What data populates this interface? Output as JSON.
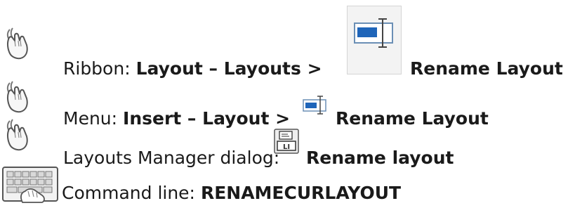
{
  "rows": [
    {
      "label": "Ribbon: ",
      "path": "Layout – Layouts >",
      "command": "Rename Layout",
      "input_icon": "mouse-pointer-icon",
      "tool_icon": "rename-layout-ribbon-icon"
    },
    {
      "label": "Menu: ",
      "path": "Insert – Layout >",
      "command": "Rename Layout",
      "input_icon": "mouse-pointer-icon",
      "tool_icon": "rename-layout-menu-icon"
    },
    {
      "label": "Layouts Manager dialog: ",
      "command": "Rename layout",
      "input_icon": "mouse-pointer-icon",
      "tool_icon": "rename-layout-dialog-icon"
    },
    {
      "label": "Command line: ",
      "command": "RENAMECURLAYOUT",
      "input_icon": "keyboard-icon"
    }
  ]
}
